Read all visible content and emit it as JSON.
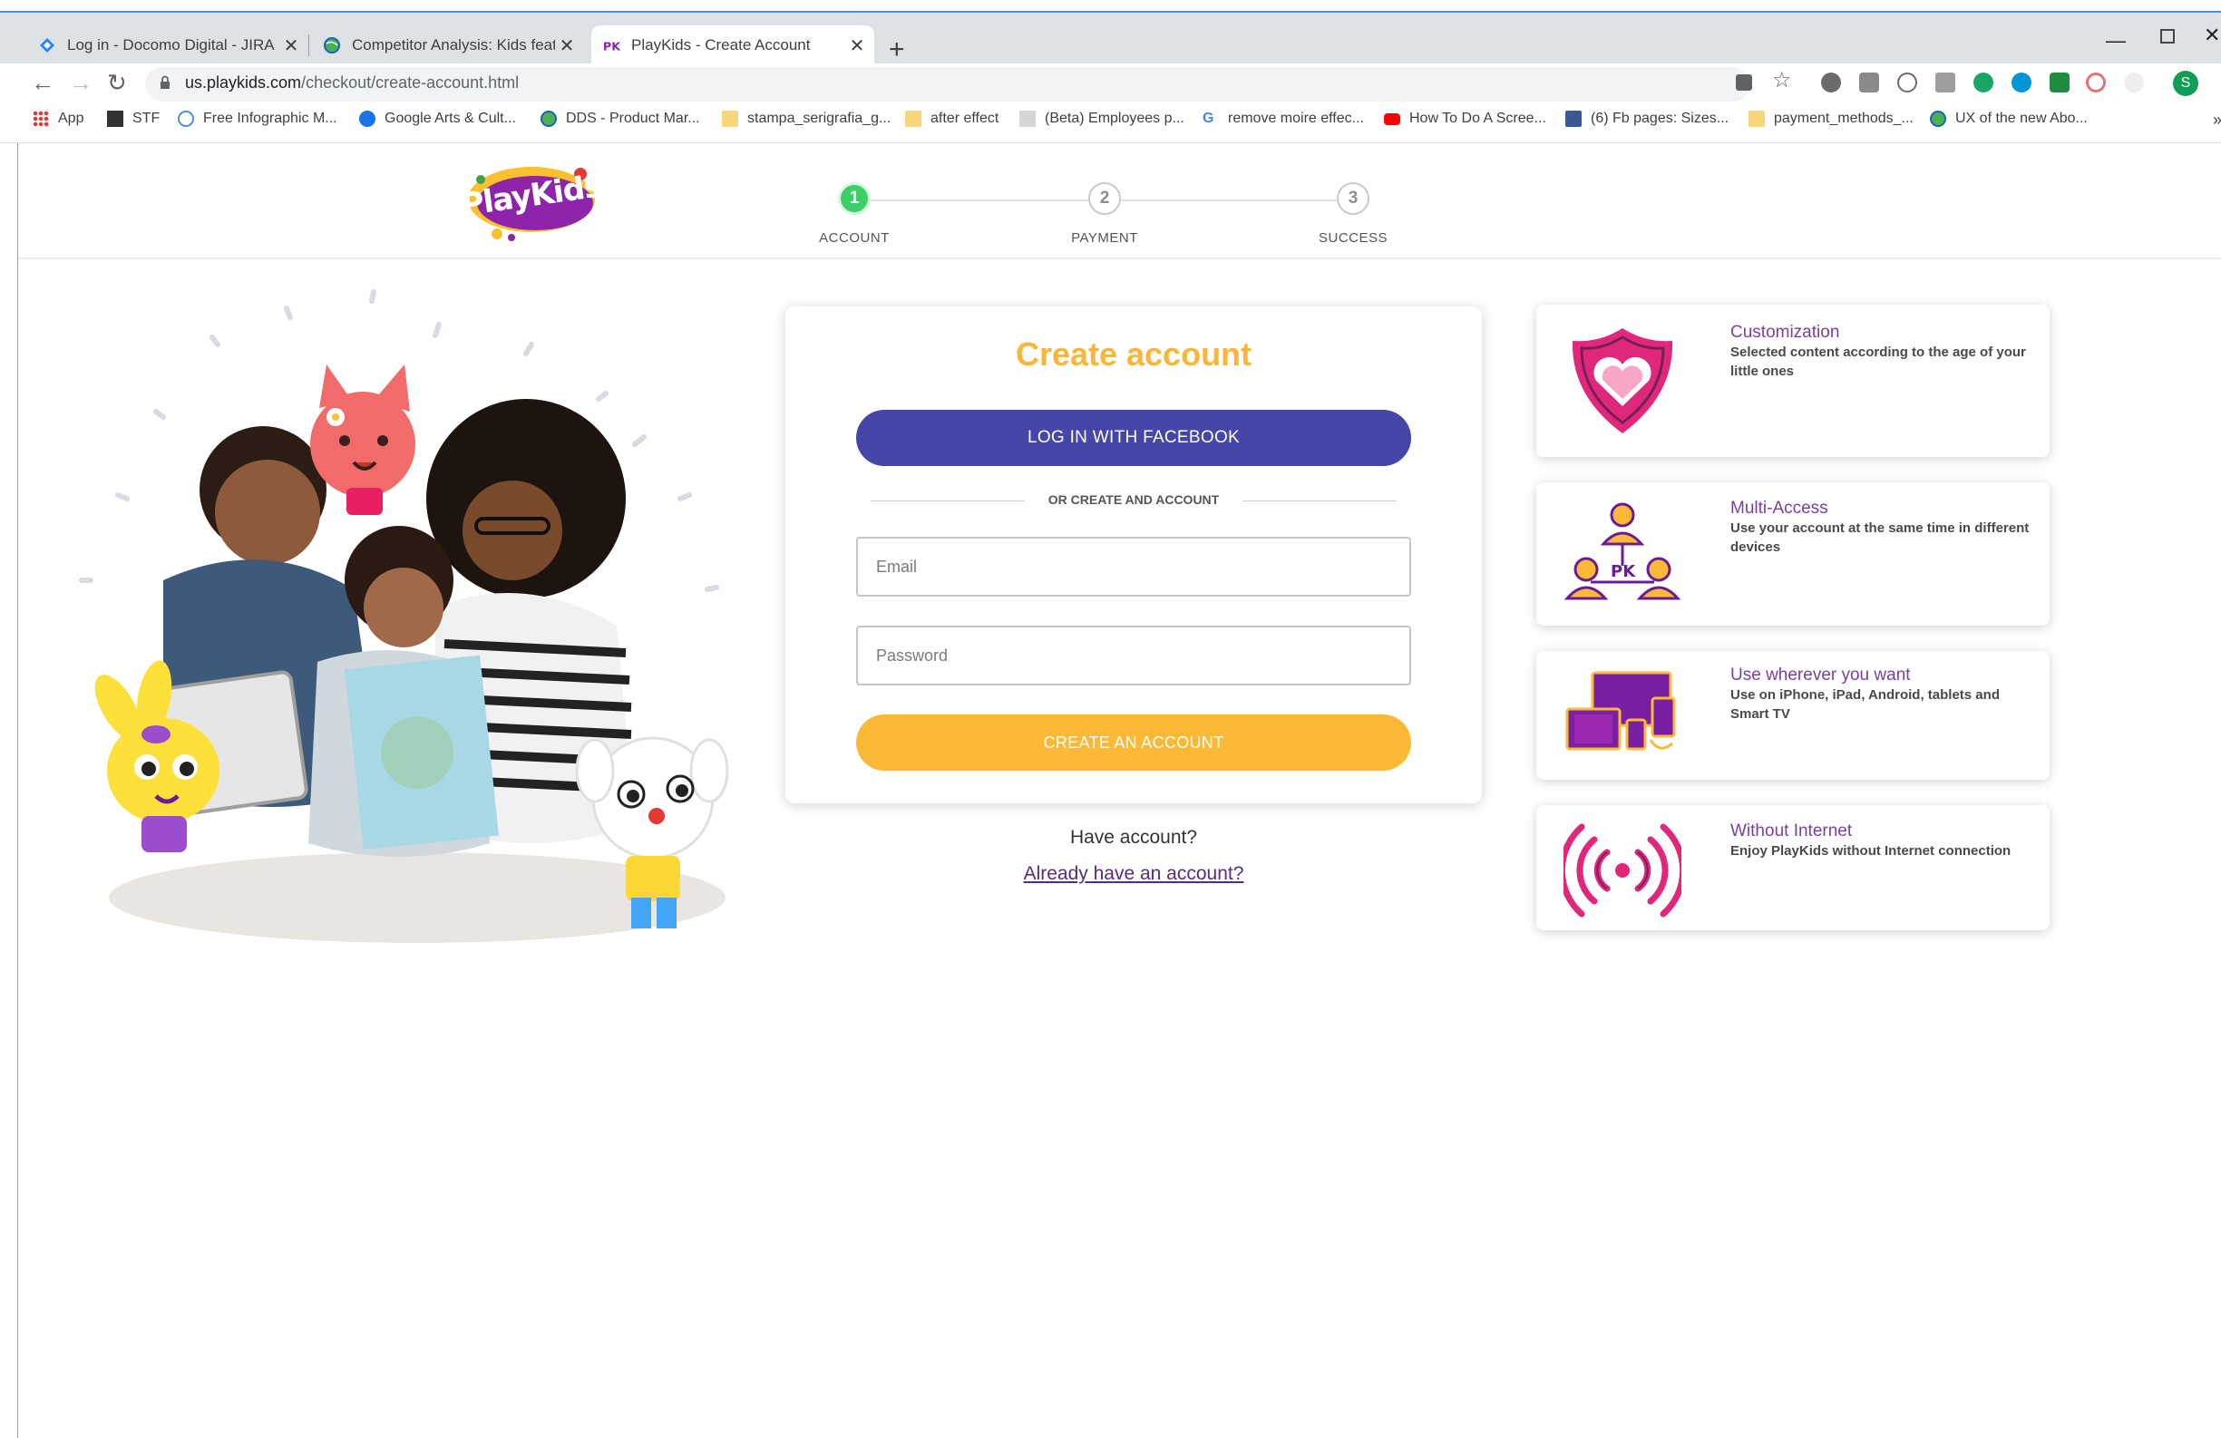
{
  "browser": {
    "tabs": [
      {
        "title": "Log in - Docomo Digital - JIRA",
        "icon": "jira-icon"
      },
      {
        "title": "Competitor Analysis: Kids feature",
        "icon": "globe-icon"
      },
      {
        "title": "PlayKids - Create Account",
        "icon": "playkids-icon",
        "active": true
      }
    ],
    "url_host": "us.playkids.com",
    "url_path": "/checkout/create-account.html",
    "profile_initial": "S",
    "bookmarks": [
      {
        "label": "App",
        "icon": "apps-grid-icon"
      },
      {
        "label": "STF",
        "icon": "stf-icon"
      },
      {
        "label": "Free Infographic M...",
        "icon": "infographic-icon"
      },
      {
        "label": "Google Arts & Cult...",
        "icon": "arts-icon"
      },
      {
        "label": "DDS - Product Mar...",
        "icon": "globe-icon"
      },
      {
        "label": "stampa_serigrafia_g...",
        "icon": "folder-icon"
      },
      {
        "label": "after effect",
        "icon": "folder-icon"
      },
      {
        "label": "(Beta) Employees p...",
        "icon": "page-icon"
      },
      {
        "label": "remove moire effec...",
        "icon": "google-icon"
      },
      {
        "label": "How To Do A Scree...",
        "icon": "youtube-icon"
      },
      {
        "label": "(6) Fb pages: Sizes...",
        "icon": "facebook-icon"
      },
      {
        "label": "payment_methods_...",
        "icon": "folder-icon"
      },
      {
        "label": "UX of the new Abo...",
        "icon": "globe-icon"
      }
    ],
    "more_bookmarks": "»"
  },
  "header": {
    "logo_text": "PlayKids",
    "steps": [
      {
        "number": "1",
        "label": "ACCOUNT",
        "state": "complete"
      },
      {
        "number": "2",
        "label": "PAYMENT",
        "state": "pending"
      },
      {
        "number": "3",
        "label": "SUCCESS",
        "state": "pending"
      }
    ]
  },
  "form": {
    "title": "Create account",
    "facebook_button": "LOG IN WITH FACEBOOK",
    "divider": "OR CREATE AND ACCOUNT",
    "email_placeholder": "Email",
    "password_placeholder": "Password",
    "create_button": "CREATE AN ACCOUNT",
    "have_account": "Have account?",
    "already_link": "Already have an account?"
  },
  "features": [
    {
      "title": "Customization",
      "description": "Selected content according to the age of your little ones",
      "icon": "heart-shield-icon"
    },
    {
      "title": "Multi-Access",
      "description": "Use your account at the same time in different devices",
      "icon": "multi-user-icon"
    },
    {
      "title": "Use wherever you want",
      "description": "Use on iPhone, iPad, Android, tablets and Smart TV",
      "icon": "devices-icon"
    },
    {
      "title": "Without Internet",
      "description": "Enjoy PlayKids without Internet connection",
      "icon": "offline-signal-icon"
    }
  ],
  "colors": {
    "brand_purple": "#4645a8",
    "brand_orange": "#fbb935",
    "step_complete": "#3ccf67",
    "feature_title": "#7b3fa0",
    "icon_pink": "#e0287a"
  }
}
